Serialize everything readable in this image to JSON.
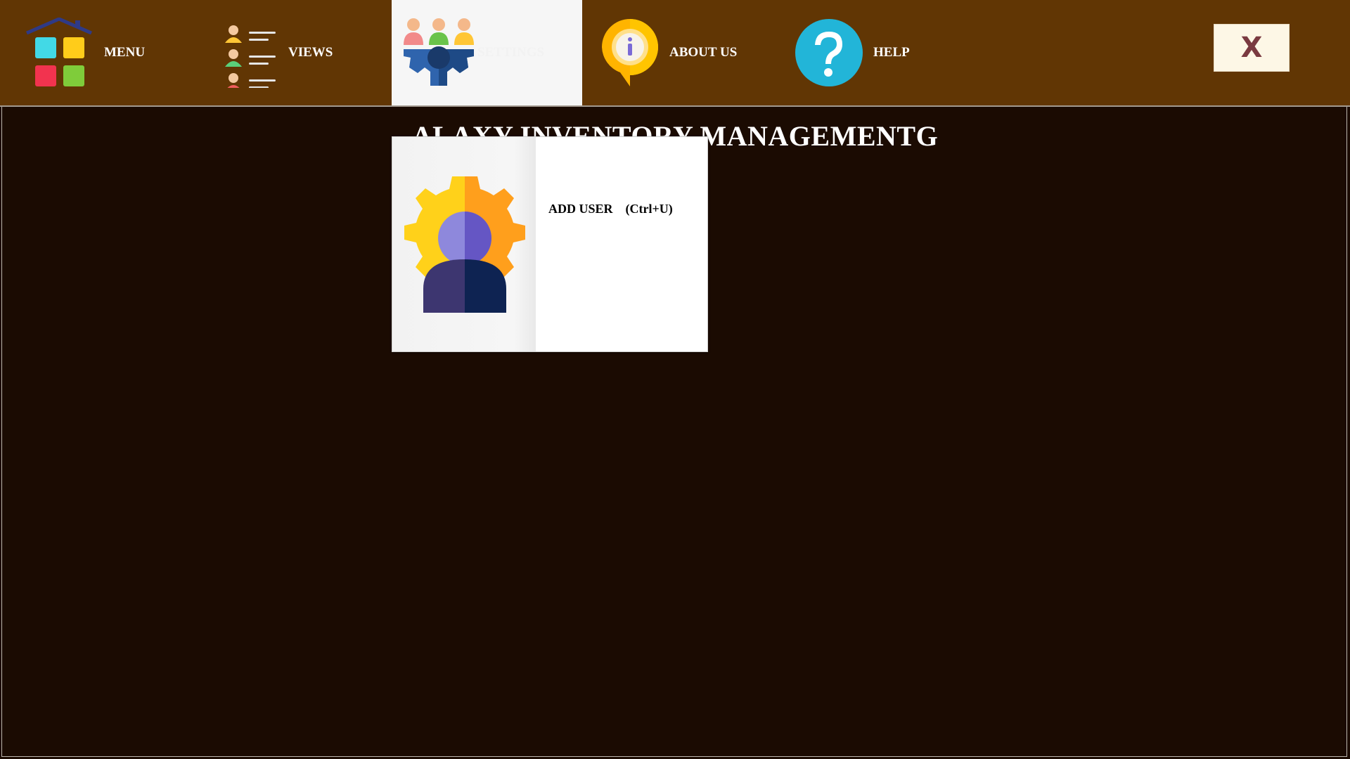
{
  "nav": {
    "menu": {
      "label": "MENU",
      "icon": "home-apps-icon"
    },
    "views": {
      "label": "VIEWS",
      "icon": "user-list-icon"
    },
    "settings": {
      "label": "SETTINGS",
      "icon": "team-gear-icon",
      "active": true
    },
    "about": {
      "label": "ABOUT US",
      "icon": "info-location-icon"
    },
    "help": {
      "label": "HELP",
      "icon": "question-icon"
    }
  },
  "close_button": {
    "label": "X"
  },
  "page": {
    "title": "ALAXY INVENTORY MANAGEMENTG"
  },
  "settings_menu": {
    "items": [
      {
        "label": "ADD USER",
        "shortcut": "(Ctrl+U)",
        "icon": "user-gear-icon"
      }
    ]
  },
  "colors": {
    "topbar": "#613604",
    "background": "#1b0b02",
    "active_tab": "#f6f6f6",
    "close_button_bg": "#fdf7e6",
    "close_button_text": "#7a3a40"
  }
}
